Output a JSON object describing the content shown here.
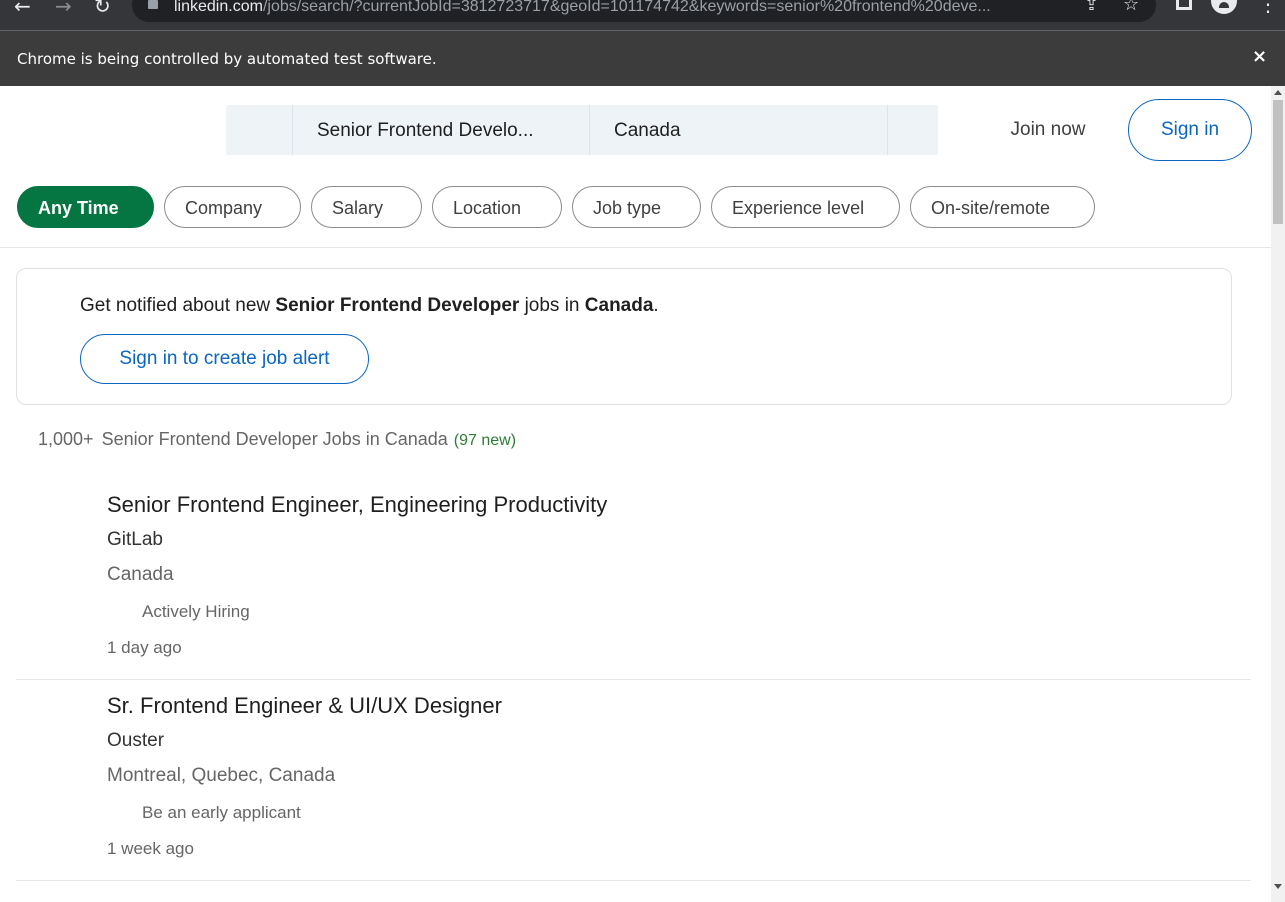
{
  "browser": {
    "url_host": "linkedin.com",
    "url_rest": "/jobs/search/?currentJobId=3812723717&geoId=101174742&keywords=senior%20frontend%20deve...",
    "infobar_text": "Chrome is being controlled by automated test software.",
    "infobar_close": "×",
    "icons": [
      "back-arrow-icon",
      "forward-arrow-icon",
      "reload-icon",
      "lock-icon",
      "share-icon",
      "star-icon",
      "extensions-icon",
      "profile-icon",
      "menu-icon"
    ]
  },
  "header": {
    "keywords_value": "Senior Frontend Develo...",
    "location_value": "Canada",
    "join_now_label": "Join now",
    "sign_in_label": "Sign in"
  },
  "filters": [
    {
      "label": "Any Time",
      "active": true
    },
    {
      "label": "Company",
      "active": false
    },
    {
      "label": "Salary",
      "active": false
    },
    {
      "label": "Location",
      "active": false
    },
    {
      "label": "Job type",
      "active": false
    },
    {
      "label": "Experience level",
      "active": false
    },
    {
      "label": "On-site/remote",
      "active": false
    }
  ],
  "alert": {
    "prefix": "Get notified about new ",
    "keyword": "Senior Frontend Developer",
    "middle": " jobs in ",
    "location": "Canada",
    "suffix": ".",
    "button_label": "Sign in to create job alert"
  },
  "results": {
    "count": "1,000+",
    "label": "Senior Frontend Developer Jobs in Canada",
    "new_count": "(97 new)"
  },
  "jobs": [
    {
      "title": "Senior Frontend Engineer, Engineering Productivity",
      "company": "GitLab",
      "location": "Canada",
      "badge": "Actively Hiring",
      "posted": "1 day ago"
    },
    {
      "title": "Sr. Frontend Engineer & UI/UX Designer",
      "company": "Ouster",
      "location": "Montreal, Quebec, Canada",
      "badge": "Be an early applicant",
      "posted": "1 week ago"
    }
  ],
  "colors": {
    "accent_blue": "#0a66c2",
    "active_green": "#057642",
    "new_green": "#2e7d32"
  }
}
